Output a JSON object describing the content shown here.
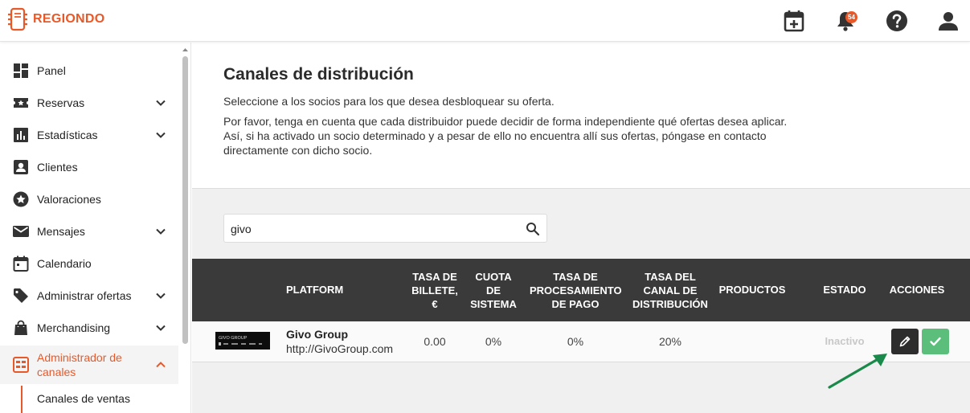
{
  "brand": {
    "name": "REGIONDO",
    "color": "#e8592a"
  },
  "topbar": {
    "icons": [
      "calendar-add-icon",
      "bell-icon",
      "help-icon",
      "user-icon"
    ],
    "notification_count": "54"
  },
  "sidebar": {
    "items": [
      {
        "label": "Panel",
        "icon": "dashboard-icon"
      },
      {
        "label": "Reservas",
        "icon": "ticket-icon"
      },
      {
        "label": "Estadísticas",
        "icon": "stats-icon"
      },
      {
        "label": "Clientes",
        "icon": "clients-icon"
      },
      {
        "label": "Valoraciones",
        "icon": "star-icon"
      },
      {
        "label": "Mensajes",
        "icon": "mail-icon"
      },
      {
        "label": "Calendario",
        "icon": "calendar-icon"
      },
      {
        "label": "Administrar ofertas",
        "icon": "tag-icon"
      },
      {
        "label": "Merchandising",
        "icon": "bag-icon"
      },
      {
        "label": "Administrador de canales",
        "icon": "channels-icon"
      }
    ],
    "subitem": "Canales de ventas"
  },
  "page": {
    "title": "Canales de distribución",
    "intro": "Seleccione a los socios para los que desea desbloquear su oferta.",
    "note": "Por favor, tenga en cuenta que cada distribuidor puede decidir de forma independiente qué ofertas desea aplicar. Así, si ha activado un socio determinado y a pesar de ello no encuentra allí sus ofertas, póngase en contacto directamente con dicho socio."
  },
  "search": {
    "value": "givo"
  },
  "table": {
    "headers": {
      "platform": "PLATFORM",
      "ticket_fee": "TASA DE BILLETE, €",
      "system_fee": "CUOTA DE SISTEMA",
      "payment_fee": "TASA DE PROCESAMIENTO DE PAGO",
      "channel_fee": "TASA DEL CANAL DE DISTRIBUCIÓN",
      "products": "PRODUCTOS",
      "status": "ESTADO",
      "actions": "ACCIONES"
    },
    "rows": [
      {
        "logo_text": "GIVO GROUP",
        "name": "Givo Group",
        "url": "http://GivoGroup.com",
        "ticket_fee": "0.00",
        "system_fee": "0%",
        "payment_fee": "0%",
        "channel_fee": "20%",
        "products": "",
        "status": "Inactivo"
      }
    ]
  },
  "colors": {
    "header_bg": "#3a3a3a",
    "check_green": "#5bbf7b",
    "arrow_green": "#1a8a4a"
  }
}
